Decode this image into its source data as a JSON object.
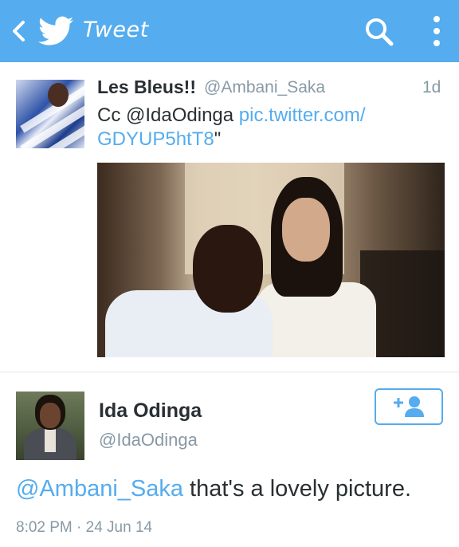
{
  "appbar": {
    "title": "Tweet",
    "back_icon": "chevron-left-icon",
    "logo_icon": "twitter-bird-icon",
    "search_icon": "search-icon",
    "menu_icon": "overflow-menu-icon"
  },
  "tweet1": {
    "name": "Les Bleus!!",
    "handle": "@Ambani_Saka",
    "time": "1d",
    "text_prefix": "Cc ",
    "mention": "@IdaOdinga",
    "link": "pic.twitter.com/\nGDYUP5htT8",
    "text_suffix": "\"",
    "photo": "tweet-photo"
  },
  "tweet2": {
    "name": "Ida Odinga",
    "handle": "@IdaOdinga",
    "follow_icon": "follow-user-icon",
    "mention": "@Ambani_Saka",
    "text": " that's a lovely picture.",
    "timestamp": "8:02 PM · 24 Jun 14"
  },
  "colors": {
    "brand": "#55acee",
    "text": "#292f33",
    "muted": "#8899a6"
  }
}
